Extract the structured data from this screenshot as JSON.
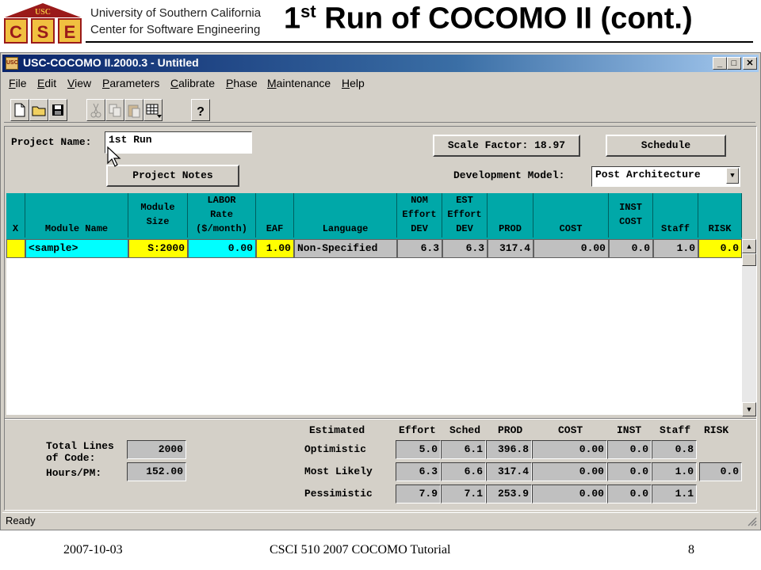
{
  "slide": {
    "org_line1": "University of Southern California",
    "org_line2": "Center for Software Engineering",
    "title_pre": "1",
    "title_sup": "st",
    "title_post": " Run of COCOMO II (cont.)",
    "logo_top": "USC",
    "logo_letters": "CSE",
    "footer_date": "2007-10-03",
    "footer_course": "CSCI 510 2007 COCOMO Tutorial",
    "footer_page": "8"
  },
  "window": {
    "title": "USC-COCOMO II.2000.3 - Untitled",
    "minimize": "_",
    "maximize": "□",
    "close": "✕"
  },
  "menu": [
    "File",
    "Edit",
    "View",
    "Parameters",
    "Calibrate",
    "Phase",
    "Maintenance",
    "Help"
  ],
  "toolbar": {
    "icons": [
      "new-document-icon",
      "open-folder-icon",
      "save-disk-icon",
      "cut-scissors-icon",
      "copy-icon",
      "paste-icon",
      "add-module-icon",
      "help-icon"
    ]
  },
  "project": {
    "name_label": "Project Name:",
    "name_value": "1st Run",
    "notes_button": "Project Notes",
    "scale_factor_button": "Scale Factor: 18.97",
    "schedule_button": "Schedule",
    "dev_model_label": "Development Model:",
    "dev_model_value": "Post Architecture"
  },
  "grid": {
    "headers": [
      {
        "id": "x",
        "lines": [
          "X"
        ]
      },
      {
        "id": "module_name",
        "lines": [
          "Module Name"
        ]
      },
      {
        "id": "module_size",
        "lines": [
          "Module",
          "Size"
        ]
      },
      {
        "id": "labor_rate",
        "lines": [
          "LABOR",
          "Rate",
          "($/month)"
        ]
      },
      {
        "id": "eaf",
        "lines": [
          "EAF"
        ]
      },
      {
        "id": "language",
        "lines": [
          "Language"
        ]
      },
      {
        "id": "nom_effort",
        "lines": [
          "NOM",
          "Effort",
          "DEV"
        ]
      },
      {
        "id": "est_effort",
        "lines": [
          "EST",
          "Effort",
          "DEV"
        ]
      },
      {
        "id": "prod",
        "lines": [
          "PROD"
        ]
      },
      {
        "id": "cost",
        "lines": [
          "COST"
        ]
      },
      {
        "id": "inst_cost",
        "lines": [
          "INST",
          "COST"
        ]
      },
      {
        "id": "staff",
        "lines": [
          "Staff"
        ]
      },
      {
        "id": "risk",
        "lines": [
          "RISK"
        ]
      }
    ],
    "row": {
      "x": "",
      "module_name": "<sample>",
      "module_size": "S:2000",
      "labor_rate": "0.00",
      "eaf": "1.00",
      "language": "Non-Specified",
      "nom_effort": "6.3",
      "est_effort": "6.3",
      "prod": "317.4",
      "cost": "0.00",
      "inst_cost": "0.0",
      "staff": "1.0",
      "risk": "0.0"
    }
  },
  "summary": {
    "total_lines_label_1": "Total Lines",
    "total_lines_label_2": "of Code:",
    "total_lines_value": "2000",
    "hours_label": "Hours/PM:",
    "hours_value": "152.00",
    "headers": [
      "Estimated",
      "Effort",
      "Sched",
      "PROD",
      "COST",
      "INST",
      "Staff",
      "RISK"
    ],
    "rows": [
      {
        "label": "Optimistic",
        "effort": "5.0",
        "sched": "6.1",
        "prod": "396.8",
        "cost": "0.00",
        "inst": "0.0",
        "staff": "0.8",
        "risk": ""
      },
      {
        "label": "Most Likely",
        "effort": "6.3",
        "sched": "6.6",
        "prod": "317.4",
        "cost": "0.00",
        "inst": "0.0",
        "staff": "1.0",
        "risk": "0.0"
      },
      {
        "label": "Pessimistic",
        "effort": "7.9",
        "sched": "7.1",
        "prod": "253.9",
        "cost": "0.00",
        "inst": "0.0",
        "staff": "1.1",
        "risk": ""
      }
    ]
  },
  "status": {
    "text": "Ready"
  }
}
